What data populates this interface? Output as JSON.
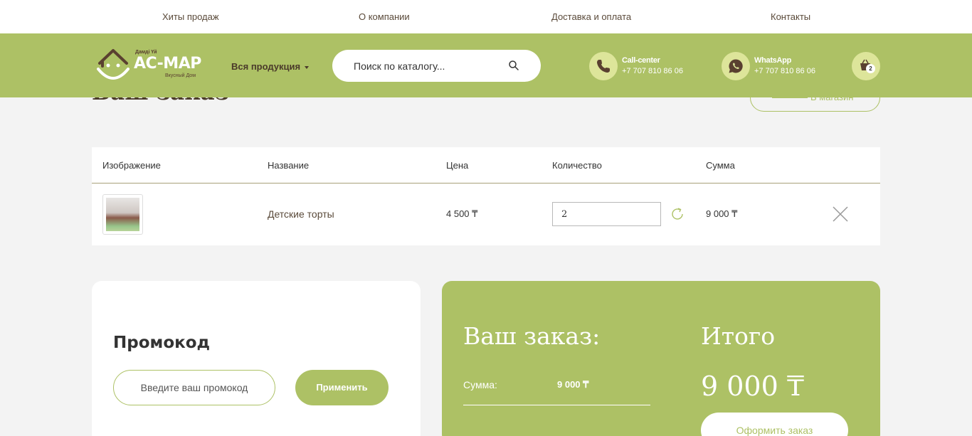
{
  "topnav": {
    "items": [
      "Хиты продаж",
      "О компании",
      "Доставка и оплата",
      "Контакты"
    ]
  },
  "header": {
    "logo": {
      "top": "Дамді Үй",
      "main": "AC-MAP",
      "sub": "Вкусный Дом"
    },
    "catalog_label": "Вся продукция",
    "search_placeholder": "Поиск по каталогу...",
    "contacts": [
      {
        "title": "Call-center",
        "phone": "+7 707 810 86 06",
        "icon": "phone-icon"
      },
      {
        "title": "WhatsApp",
        "phone": "+7 707 810 86 06",
        "icon": "whatsapp-icon"
      }
    ],
    "cart_count": "2",
    "accent_color": "#adc165"
  },
  "page": {
    "title": "Ваш заказ",
    "back_label": "В магазин"
  },
  "table": {
    "headers": [
      "Изображение",
      "Название",
      "Цена",
      "Количество",
      "Сумма"
    ],
    "rows": [
      {
        "name": "Детские торты",
        "price": "4 500 ₸",
        "quantity": "2",
        "sum": "9 000 ₸"
      }
    ]
  },
  "promo": {
    "title": "Промокод",
    "placeholder": "Введите ваш промокод",
    "apply_label": "Применить"
  },
  "summary": {
    "title": "Ваш заказ:",
    "sum_label": "Сумма:",
    "sum_value": "9 000 ₸",
    "total_title": "Итого",
    "total_value": "9 000 ₸",
    "checkout_label": "Оформить заказ"
  }
}
